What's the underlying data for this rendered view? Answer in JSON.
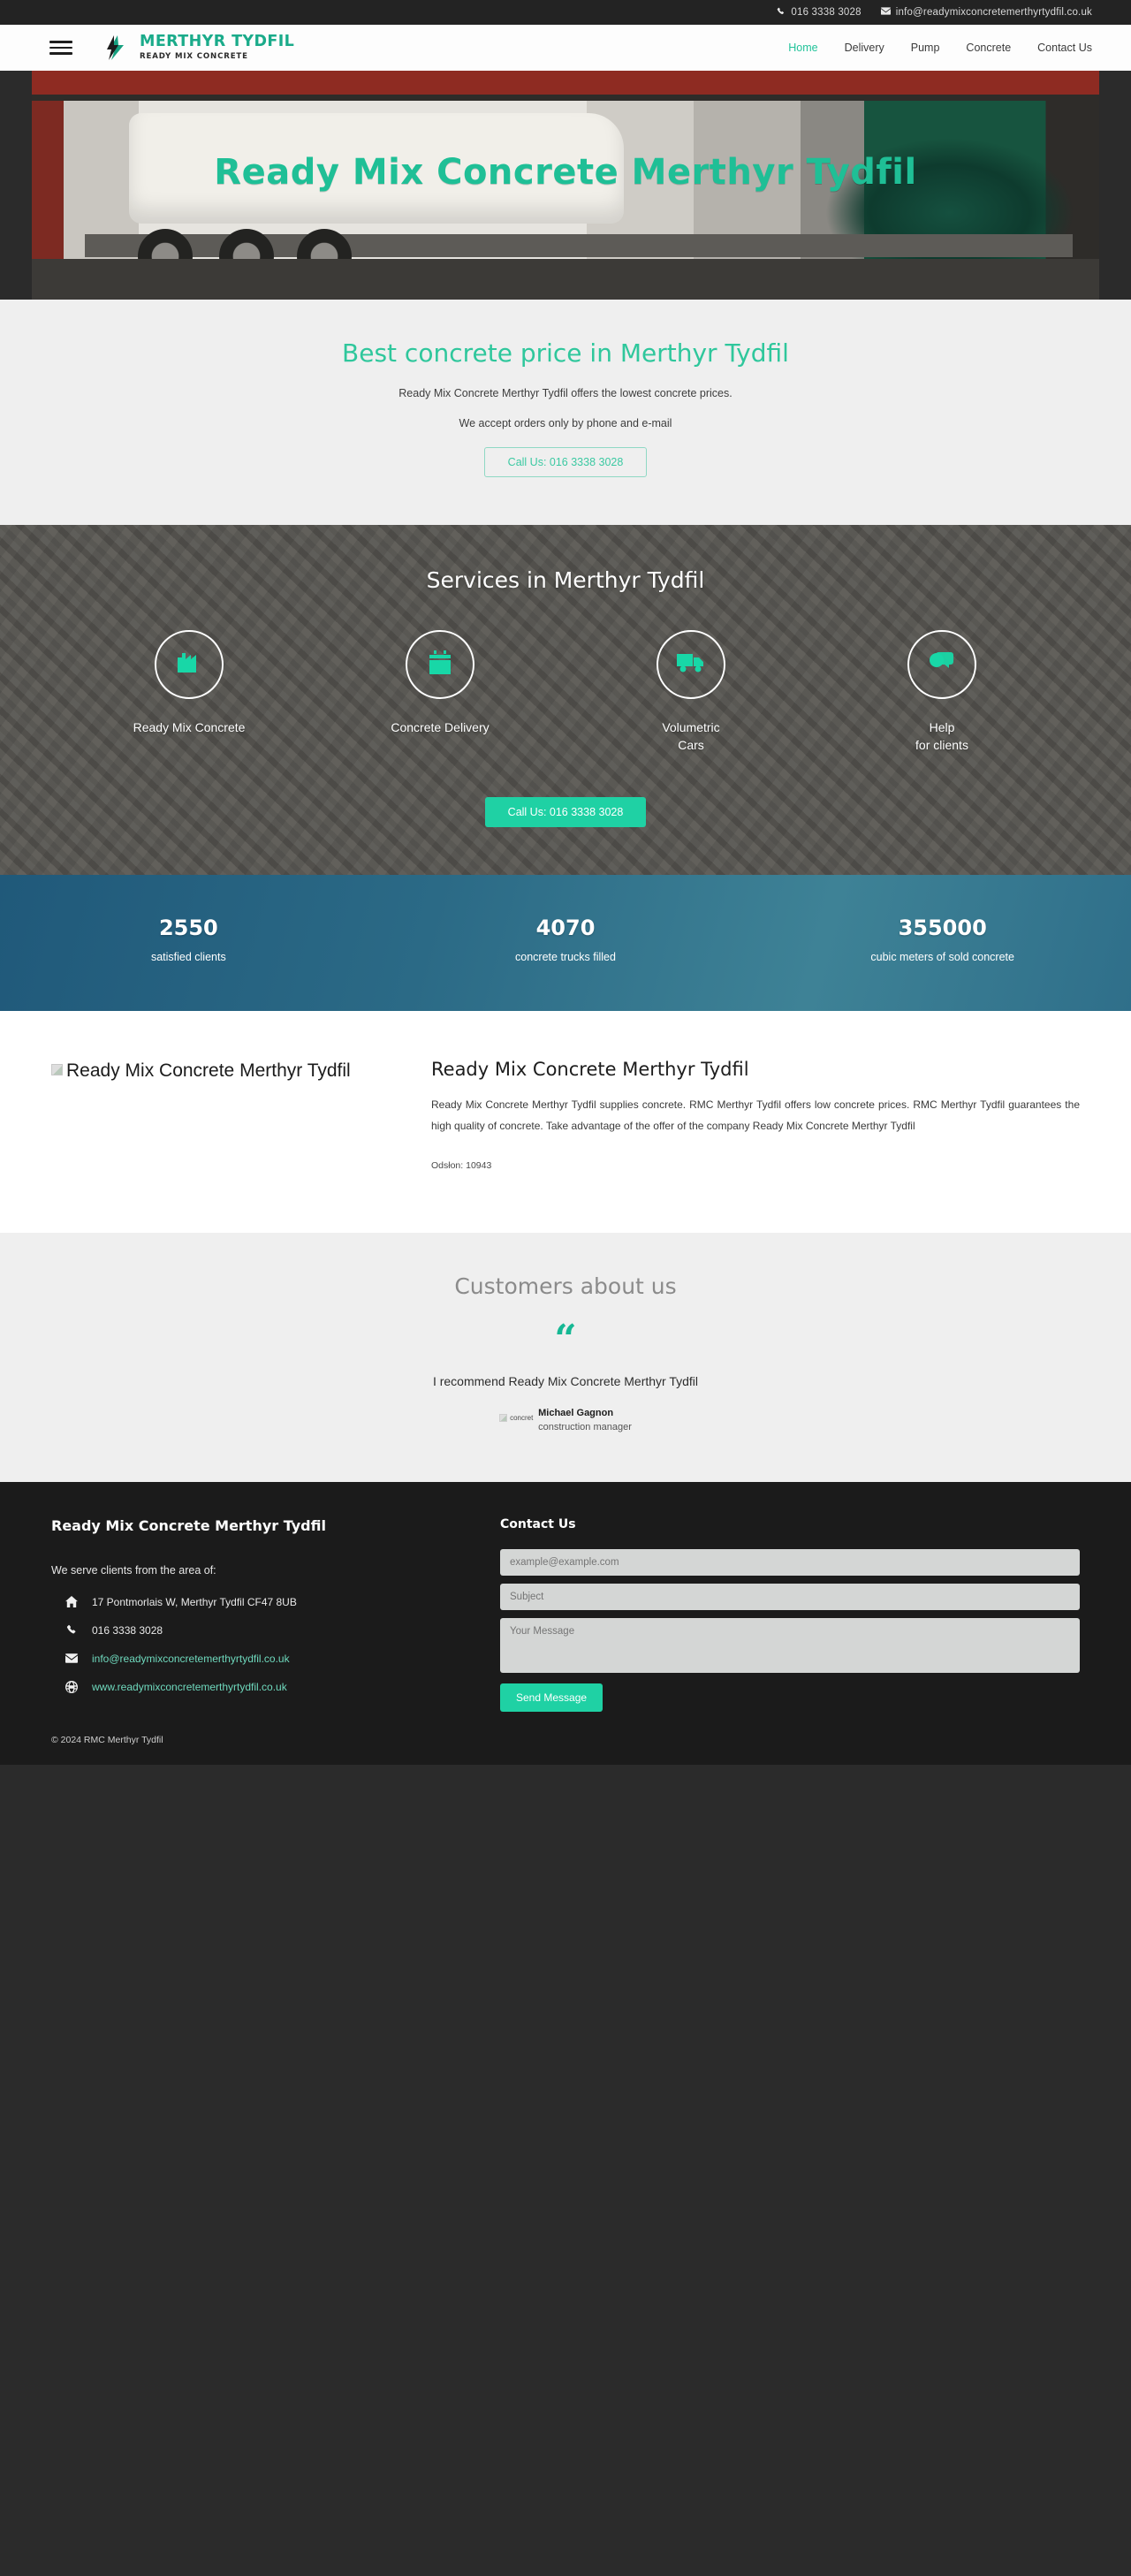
{
  "topbar": {
    "phone": "016 3338 3028",
    "email": "info@readymixconcretemerthyrtydfil.co.uk",
    "phone_icon": "phone-icon",
    "mail_icon": "envelope-icon"
  },
  "header": {
    "menu_icon": "hamburger-menu-icon",
    "logo_icon": "lightning-logo-icon",
    "brand_line1": "MERTHYR TYDFIL",
    "brand_line2": "READY MIX CONCRETE",
    "nav": [
      {
        "label": "Home",
        "active": true
      },
      {
        "label": "Delivery",
        "active": false
      },
      {
        "label": "Pump",
        "active": false
      },
      {
        "label": "Concrete",
        "active": false
      },
      {
        "label": "Contact Us",
        "active": false
      }
    ]
  },
  "hero": {
    "title": "Ready Mix Concrete Merthyr Tydfil"
  },
  "price": {
    "heading": "Best concrete price in Merthyr Tydfil",
    "line1": "Ready Mix Concrete Merthyr Tydfil offers the lowest concrete prices.",
    "line2": "We accept orders only by phone and e-mail",
    "cta": "Call Us: 016 3338 3028"
  },
  "services": {
    "heading": "Services in Merthyr Tydfil",
    "items": [
      {
        "label": "Ready Mix Concrete",
        "icon": "factory-icon"
      },
      {
        "label": "Concrete Delivery",
        "icon": "calendar-icon"
      },
      {
        "label": "Volumetric\nCars",
        "icon": "truck-icon"
      },
      {
        "label": "Help\nfor clients",
        "icon": "chat-bubbles-icon"
      }
    ],
    "cta": "Call Us: 016 3338 3028"
  },
  "stats": [
    {
      "num": "2550",
      "cap": "satisfied clients"
    },
    {
      "num": "4070",
      "cap": "concrete trucks filled"
    },
    {
      "num": "355000",
      "cap": "cubic meters of sold concrete"
    }
  ],
  "about": {
    "image_alt": "Ready Mix Concrete Merthyr Tydfil",
    "heading": "Ready Mix Concrete Merthyr Tydfil",
    "body": "Ready Mix Concrete Merthyr Tydfil supplies concrete. RMC Merthyr Tydfil offers low concrete prices. RMC Merthyr Tydfil guarantees the high quality of concrete. Take advantage of the offer of the company Ready Mix Concrete Merthyr Tydfil",
    "views": "Odsłon: 10943"
  },
  "testimonials": {
    "heading": "Customers about us",
    "quote_icon": "quote-icon",
    "quote": "I recommend Ready Mix Concrete Merthyr Tydfil",
    "avatar_alt": "concret",
    "author_name": "Michael Gagnon",
    "author_role": "construction manager"
  },
  "footer": {
    "company": "Ready Mix Concrete Merthyr Tydfil",
    "serve": "We serve clients from the area of:",
    "contacts": [
      {
        "icon": "home-icon",
        "text": "17 Pontmorlais W, Merthyr Tydfil CF47 8UB",
        "link": false
      },
      {
        "icon": "phone-icon",
        "text": "016 3338 3028",
        "link": false
      },
      {
        "icon": "envelope-icon",
        "text": "info@readymixconcretemerthyrtydfil.co.uk",
        "link": true
      },
      {
        "icon": "globe-icon",
        "text": "www.readymixconcretemerthyrtydfil.co.uk",
        "link": true
      }
    ],
    "form": {
      "heading": "Contact Us",
      "email_placeholder": "example@example.com",
      "subject_placeholder": "Subject",
      "message_placeholder": "Your Message",
      "submit": "Send Message"
    },
    "copyright": "© 2024 RMC Merthyr Tydfil"
  },
  "colors": {
    "accent": "#1fd1a4",
    "accent_dark": "#16b894",
    "topbar_bg": "#232323",
    "footer_bg": "#1b1b1b",
    "stats_bg": "#2b6a86"
  }
}
